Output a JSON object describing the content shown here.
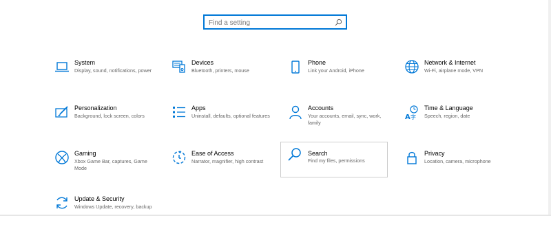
{
  "search": {
    "placeholder": "Find a setting",
    "icon": "search-icon"
  },
  "accent": "#0078d7",
  "tiles": [
    {
      "title": "System",
      "description": "Display, sound, notifications, power",
      "icon": "laptop-icon"
    },
    {
      "title": "Devices",
      "description": "Bluetooth, printers, mouse",
      "icon": "devices-icon"
    },
    {
      "title": "Phone",
      "description": "Link your Android, iPhone",
      "icon": "phone-icon"
    },
    {
      "title": "Network & Internet",
      "description": "Wi-Fi, airplane mode, VPN",
      "icon": "globe-icon"
    },
    {
      "title": "Personalization",
      "description": "Background, lock screen, colors",
      "icon": "paintbrush-icon"
    },
    {
      "title": "Apps",
      "description": "Uninstall, defaults, optional features",
      "icon": "apps-list-icon"
    },
    {
      "title": "Accounts",
      "description": "Your accounts, email, sync, work, family",
      "icon": "person-icon"
    },
    {
      "title": "Time & Language",
      "description": "Speech, region, date",
      "icon": "time-language-icon"
    },
    {
      "title": "Gaming",
      "description": "Xbox Game Bar, captures, Game Mode",
      "icon": "xbox-icon"
    },
    {
      "title": "Ease of Access",
      "description": "Narrator, magnifier, high contrast",
      "icon": "ease-of-access-icon"
    },
    {
      "title": "Search",
      "description": "Find my files, permissions",
      "icon": "search-icon"
    },
    {
      "title": "Privacy",
      "description": "Location, camera, microphone",
      "icon": "lock-icon"
    },
    {
      "title": "Update & Security",
      "description": "Windows Update, recovery, backup",
      "icon": "sync-icon"
    }
  ]
}
